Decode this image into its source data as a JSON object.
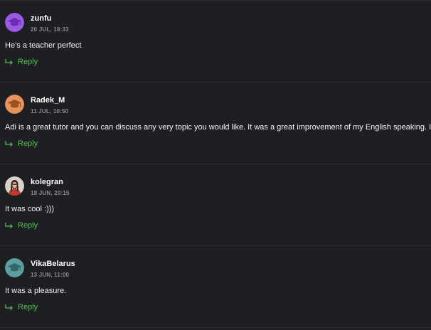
{
  "comments": [
    {
      "username": "zunfu",
      "timestamp": "20 JUL, 18:33",
      "text": "He’s a teacher perfect",
      "reply_label": "Reply",
      "avatar": {
        "type": "graduation-cap-icon",
        "color": "#9b59e6"
      }
    },
    {
      "username": "Radek_M",
      "timestamp": "11 JUL, 10:50",
      "text": "Adi is a great tutor and you can discuss any very topic you would like. It was a great improvement of my English speaking. I recommend hi",
      "reply_label": "Reply",
      "avatar": {
        "type": "graduation-cap-icon",
        "color": "#e8935a"
      }
    },
    {
      "username": "kolegran",
      "timestamp": "18 JUN, 20:15",
      "text": "It was cool :)))",
      "reply_label": "Reply",
      "avatar": {
        "type": "user-photo",
        "color": "#c0392b"
      }
    },
    {
      "username": "VikaBelarus",
      "timestamp": "13 JUN, 11:00",
      "text": "It was a pleasure.",
      "reply_label": "Reply",
      "avatar": {
        "type": "graduation-cap-icon",
        "color": "#5d9ea0"
      }
    }
  ],
  "colors": {
    "background": "#1e1f23",
    "reply": "#5cb85c",
    "timestamp": "#8a8b90",
    "divider": "#2c2d32"
  }
}
